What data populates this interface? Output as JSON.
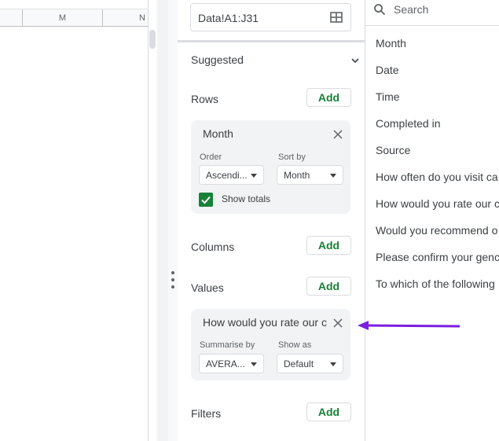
{
  "sheet": {
    "columns": [
      "M",
      "N"
    ]
  },
  "editor": {
    "range": "Data!A1:J31",
    "suggested_label": "Suggested",
    "add_label": "Add",
    "rows": {
      "title": "Rows",
      "card": {
        "title": "Month",
        "order_label": "Order",
        "order_value": "Ascendi...",
        "sort_label": "Sort by",
        "sort_value": "Month",
        "show_totals_label": "Show totals",
        "show_totals_checked": true
      }
    },
    "columns_title": "Columns",
    "values": {
      "title": "Values",
      "card": {
        "title": "How would you rate our c",
        "summarise_label": "Summarise by",
        "summarise_value": "AVERA...",
        "show_as_label": "Show as",
        "show_as_value": "Default"
      }
    },
    "filters_title": "Filters"
  },
  "field_list": {
    "search_placeholder": "Search",
    "items": [
      "Month",
      "Date",
      "Time",
      "Completed in",
      "Source",
      "How often do you visit ca",
      "How would you rate our c",
      "Would you recommend o",
      "Please confirm your genc",
      "To which of the following"
    ]
  },
  "colors": {
    "accent_green": "#188038",
    "annotation_arrow": "#7b1fe0"
  }
}
